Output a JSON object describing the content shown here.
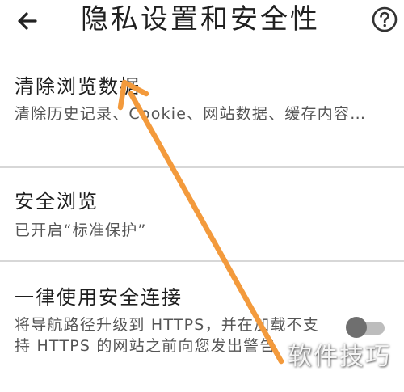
{
  "header": {
    "title": "隐私设置和安全性",
    "back_icon": "arrow-left-icon",
    "help_icon": "help-circle-icon"
  },
  "settings": {
    "clear_browsing": {
      "title": "清除浏览数据",
      "subtitle": "清除历史记录、Cookie、网站数据、缓存内容…"
    },
    "safe_browsing": {
      "title": "安全浏览",
      "subtitle": "已开启“标准保护”"
    },
    "always_secure": {
      "title": "一律使用安全连接",
      "subtitle": "将导航路径升级到 HTTPS，并在加载不支持 HTTPS 的网站之前向您发出警告",
      "enabled": false
    }
  },
  "watermark": {
    "text": "软件技巧"
  },
  "annotation": {
    "color": "#F39A3C",
    "icon": "arrow-up-left-icon"
  }
}
